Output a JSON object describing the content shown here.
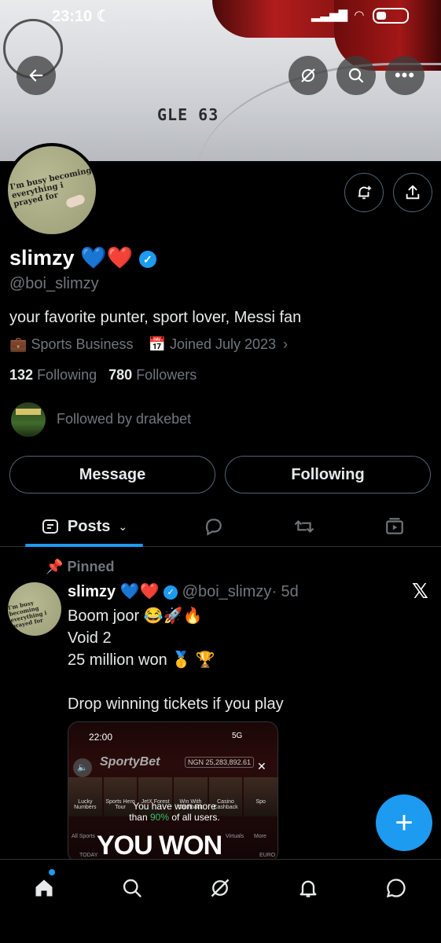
{
  "status_bar": {
    "time": "23:10"
  },
  "profile": {
    "name": "slimzy",
    "name_emojis": "💙❤️",
    "handle": "@boi_slimzy",
    "bio": "your favorite punter, sport lover, Messi fan",
    "category": "Sports Business",
    "joined": "Joined July 2023",
    "following_count": "132",
    "following_label": "Following",
    "followers_count": "780",
    "followers_label": "Followers",
    "followed_by": "Followed by drakebet",
    "banner_badge": "GLE 63",
    "avatar_caption": "I'm busy becoming everything i prayed for"
  },
  "actions": {
    "message": "Message",
    "following": "Following"
  },
  "tabs": {
    "posts": "Posts"
  },
  "pinned_label": "Pinned",
  "post": {
    "name": "slimzy",
    "emojis": "💙❤️",
    "handle": "@boi_slimzy",
    "time": "· 5d",
    "text": "Boom joor 😂🚀🔥\nVoid 2\n25 million won 🥇 🏆\n\nDrop winning tickets if you play",
    "media": {
      "time": "22:00",
      "network": "5G",
      "brand": "SportyBet",
      "balance": "NGN 25,283,892.61",
      "tiles": [
        "Lucky Numbers",
        "Sports Hero Tour",
        "JetX Forest",
        "Win With Cashback",
        "Casino Cashback",
        "Spo"
      ],
      "overlay_line1": "You have won more",
      "overlay_line2_prefix": "than",
      "overlay_percent": "90%",
      "overlay_line2_suffix": "of all users.",
      "headline": "YOU WON",
      "bottom_row": [
        "All Sports",
        "TODAY",
        "Virtuals",
        "More",
        "EURO"
      ]
    }
  },
  "colors": {
    "accent": "#1d9bf0",
    "muted": "#71767b",
    "border": "#2f3336"
  }
}
